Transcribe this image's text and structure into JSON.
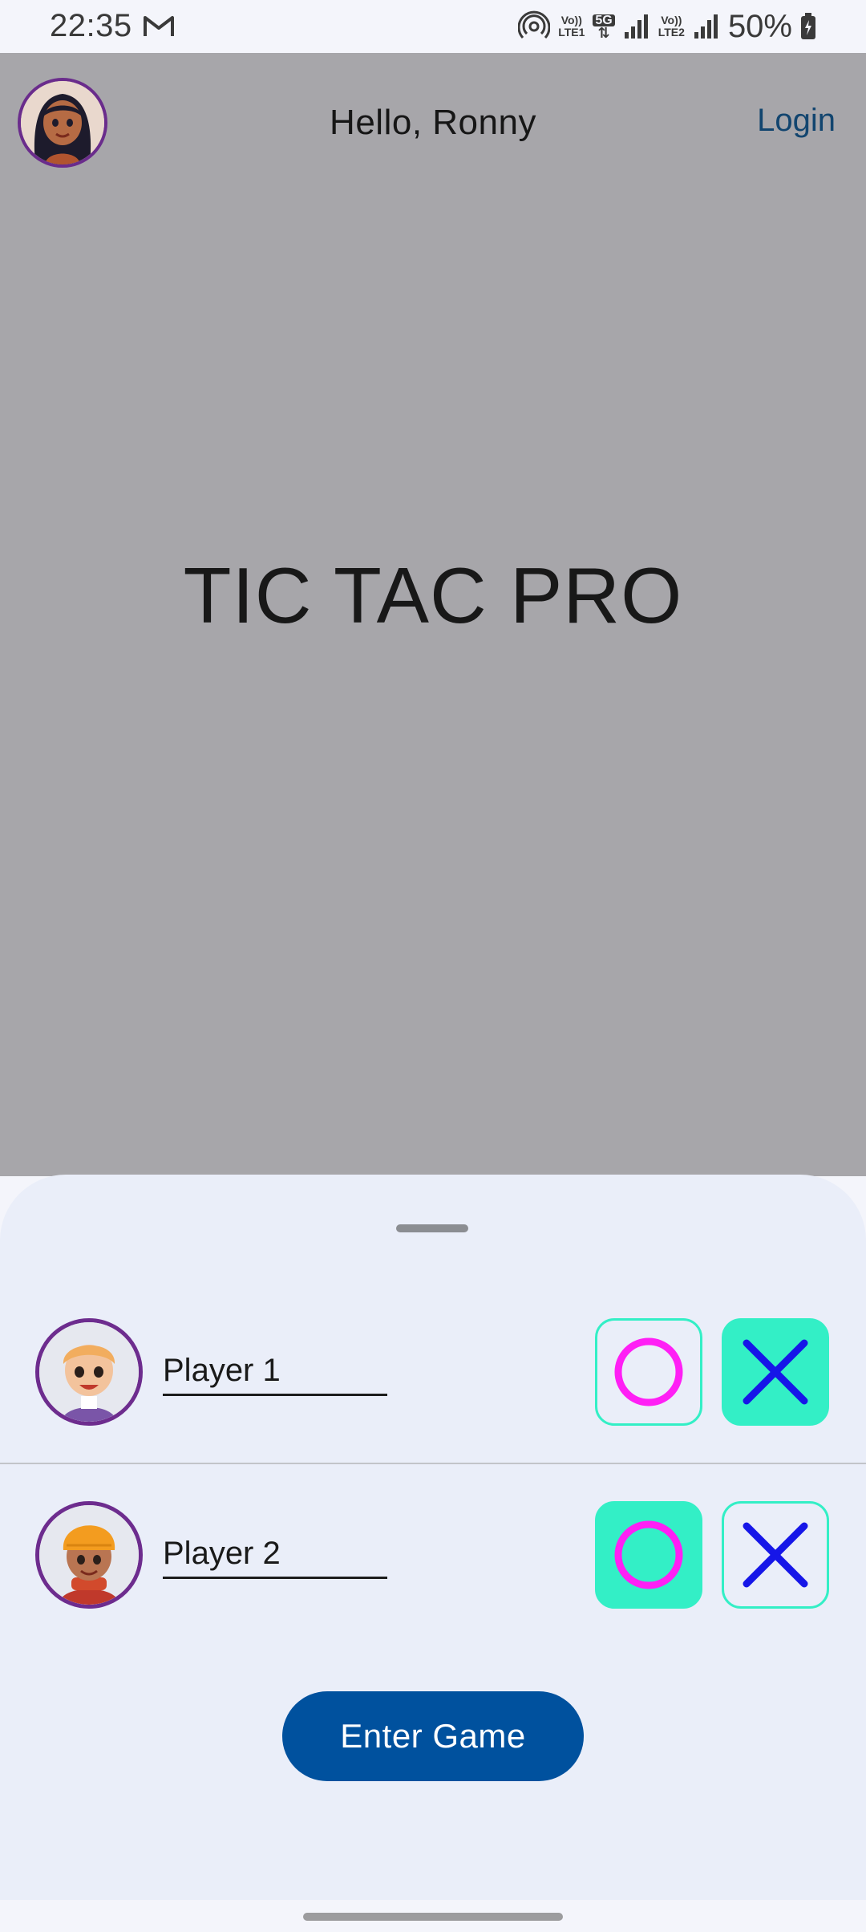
{
  "status_bar": {
    "time": "22:35",
    "mail_icon": "gmail-icon",
    "signal_label_1_top": "Vo))",
    "signal_label_1_bottom": "LTE1",
    "network_type": "5G",
    "signal_label_2_top": "Vo))",
    "signal_label_2_bottom": "LTE2",
    "battery": "50%"
  },
  "header": {
    "greeting": "Hello, Ronny",
    "login_label": "Login"
  },
  "app": {
    "title": "TIC TAC PRO"
  },
  "players": [
    {
      "name": "Player 1",
      "selected_symbol": "X"
    },
    {
      "name": "Player 2",
      "selected_symbol": "O"
    }
  ],
  "actions": {
    "enter_game_label": "Enter Game"
  },
  "colors": {
    "accent": "#33efc6",
    "o_symbol": "#ff1ff5",
    "x_symbol": "#1616e8",
    "primary_button": "#00519e",
    "avatar_ring": "#6a2c8c"
  }
}
